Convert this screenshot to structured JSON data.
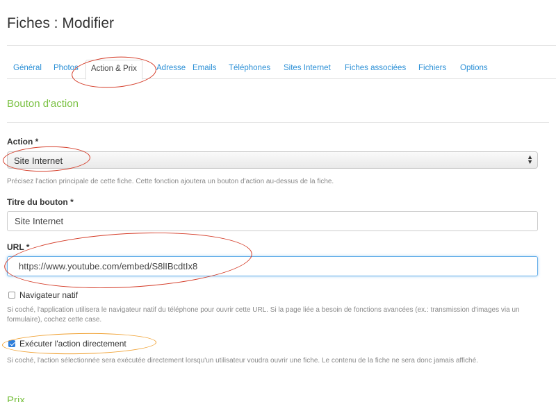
{
  "page": {
    "title": "Fiches : Modifier"
  },
  "tabs": [
    {
      "label": "Général"
    },
    {
      "label": "Photos"
    },
    {
      "label": "Action & Prix"
    },
    {
      "label": "Adresse"
    },
    {
      "label": "Emails"
    },
    {
      "label": "Téléphones"
    },
    {
      "label": "Sites Internet"
    },
    {
      "label": "Fiches associées"
    },
    {
      "label": "Fichiers"
    },
    {
      "label": "Options"
    }
  ],
  "active_tab": "Action & Prix",
  "sections": {
    "action": {
      "title": "Bouton d'action"
    },
    "prix": {
      "title": "Prix"
    }
  },
  "form": {
    "action": {
      "label": "Action *",
      "value": "Site Internet",
      "help": "Précisez l'action principale de cette fiche. Cette fonction ajoutera un bouton d'action au-dessus de la fiche."
    },
    "button_title": {
      "label": "Titre du bouton *",
      "value": "Site Internet"
    },
    "url": {
      "label": "URL *",
      "value": "https://www.youtube.com/embed/S8lIBcdtIx8"
    },
    "native_browser": {
      "label": "Navigateur natif",
      "checked": false,
      "help": "Si coché, l'application utilisera le navigateur natif du téléphone pour ouvrir cette URL. Si la page liée a besoin de fonctions avancées (ex.: transmission d'images via un formulaire), cochez cette case."
    },
    "execute_directly": {
      "label": "Exécuter l'action directement",
      "checked": true,
      "help": "Si coché, l'action sélectionnée sera exécutée directement lorsqu'un utilisateur voudra ouvrir une fiche. Le contenu de la fiche ne sera donc jamais affiché."
    }
  },
  "colors": {
    "link": "#2a8fd6",
    "section_title": "#7ac142",
    "annotation_red": "#d43a26",
    "annotation_orange": "#f0a030",
    "checkbox_checked": "#2f7fdc"
  }
}
